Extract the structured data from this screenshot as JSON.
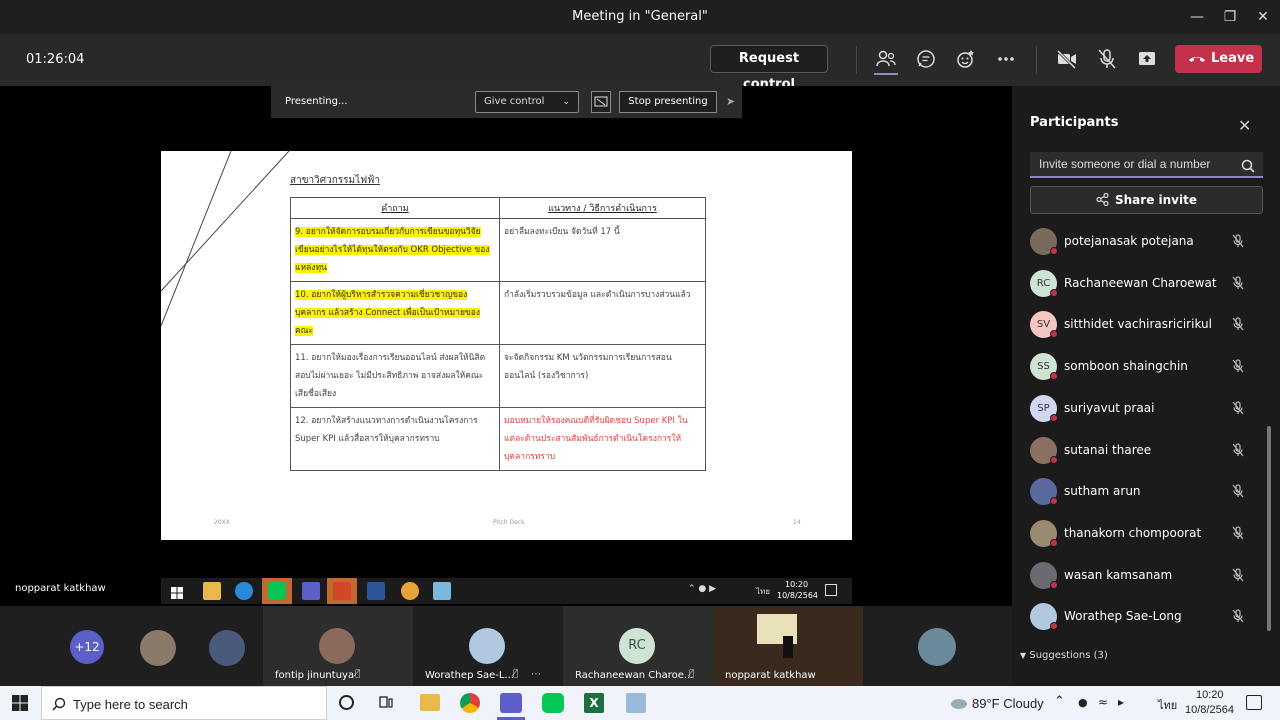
{
  "window": {
    "title": "Meeting in \"General\""
  },
  "toolbar": {
    "timer": "01:26:04",
    "request_control": "Request control",
    "leave": "Leave"
  },
  "presenting_bar": {
    "status": "Presenting...",
    "give_control": "Give control",
    "stop_presenting": "Stop presenting"
  },
  "slide": {
    "heading": "สาขาวิศวกรรมไฟฟ้า",
    "columns": [
      "คำถาม",
      "แนวทาง / วิธีการดำเนินการ"
    ],
    "rows": [
      {
        "q": "9. อยากให้จัดการอบรมเกี่ยวกับการเขียนขอทุนวิจัย เขียนอย่างไรให้ได้ทุนให้ตรงกับ OKR Objective ของแหล่งทุน",
        "a": "อย่าลืมลงทะเบียน จัดวันที่ 17 นี้"
      },
      {
        "q": "10. อยากให้ผู้บริหารสำรวจความเชี่ยวชาญของบุคลากร แล้วสร้าง Connect เพื่อเป็นเป้าหมายของคณะ",
        "a": "กำลังเริ่มรวบรวมข้อมูล และดำเนินการบางส่วนแล้ว"
      },
      {
        "q": "11. อยากให้มองเรื่องการเรียนออนไลน์ ส่งผลให้นิสิตสอบไม่ผ่านเยอะ ไม่มีประสิทธิภาพ อาจส่งผลให้คณะเสียชื่อเสียง",
        "a": "จะจัดกิจกรรม KM นวัตกรรมการเรียนการสอนออนไลน์ (รองวิชาการ)"
      },
      {
        "q": "12. อยากให้สร้างแนวทางการดำเนินงานโครงการ Super KPI แล้วสื่อสารให้บุคลากรทราบ",
        "a": "มอบหมายให้รองคณบดีที่รับผิดชอบ Super KPI ในแต่ละด้านประสานสัมพันธ์การดำเนินโครงการให้บุคลากรทราบ"
      }
    ],
    "footer_left": "20XX",
    "footer_center": "Pitch Deck",
    "footer_right": "14"
  },
  "presenter_name": "nopparat katkhaw",
  "shared_taskbar": {
    "time": "10:20",
    "date": "10/8/2564",
    "lang": "ไทย"
  },
  "panel": {
    "title": "Participants",
    "invite_placeholder": "Invite someone or dial a number",
    "share_invite": "Share invite",
    "participants": [
      {
        "name": "potejanasak potejana",
        "initials": "",
        "color": "#7a6a5a"
      },
      {
        "name": "Rachaneewan Charoewat",
        "initials": "RC",
        "color": "#cfe3d4"
      },
      {
        "name": "sitthidet vachirasricirikul",
        "initials": "SV",
        "color": "#f5c7c0"
      },
      {
        "name": "somboon shaingchin",
        "initials": "SS",
        "color": "#cfe3d4"
      },
      {
        "name": "suriyavut praai",
        "initials": "SP",
        "color": "#cfd8f0"
      },
      {
        "name": "sutanai tharee",
        "initials": "",
        "color": "#8a7060"
      },
      {
        "name": "sutham arun",
        "initials": "",
        "color": "#5a6aa0"
      },
      {
        "name": "thanakorn chompoorat",
        "initials": "",
        "color": "#9a8a70"
      },
      {
        "name": "wasan kamsanam",
        "initials": "",
        "color": "#6a6a70"
      },
      {
        "name": "Worathep Sae-Long",
        "initials": "",
        "color": "#b0c8e0"
      }
    ],
    "suggestions": "Suggestions (3)"
  },
  "gallery": {
    "more_count": "+12",
    "tiles": [
      {
        "label": "fontip jinuntuya"
      },
      {
        "label": "Worathep Sae-L..."
      },
      {
        "label": "Rachaneewan Charoe...",
        "initials": "RC"
      },
      {
        "label": "nopparat katkhaw"
      }
    ]
  },
  "win_taskbar": {
    "search_placeholder": "Type here to search",
    "weather": "89°F  Cloudy",
    "lang": "ไทย",
    "time": "10:20",
    "date": "10/8/2564"
  }
}
